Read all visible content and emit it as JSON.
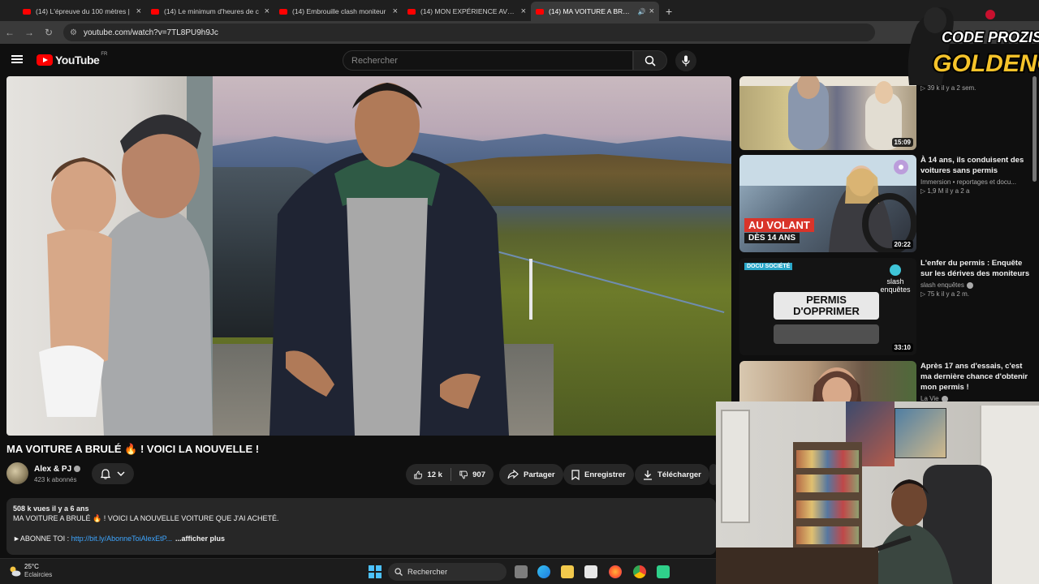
{
  "browser": {
    "tabs": [
      {
        "title": "(14) L'épreuve du 100 mètres |",
        "active": false
      },
      {
        "title": "(14) Le minimum d'heures de c",
        "active": false
      },
      {
        "title": "(14) Embrouille clash moniteur",
        "active": false
      },
      {
        "title": "(14) MON EXPÉRIENCE AVEC LE",
        "active": false
      },
      {
        "title": "(14) MA VOITURE A BRULÉ",
        "active": true
      }
    ],
    "url": "youtube.com/watch?v=7TL8PU9h9Jc"
  },
  "youtube": {
    "logo_text": "YouTube",
    "region": "FR",
    "search_placeholder": "Rechercher"
  },
  "video": {
    "title": "MA VOITURE A BRULÉ 🔥 ! VOICI LA NOUVELLE !",
    "channel": "Alex & PJ",
    "subscribers": "423 k abonnés",
    "likes": "12 k",
    "dislikes": "907",
    "share_label": "Partager",
    "save_label": "Enregistrer",
    "download_label": "Télécharger"
  },
  "description": {
    "meta": "508 k vues  il y a 6 ans",
    "line1": "MA VOITURE A BRULÉ 🔥 ! VOICI LA NOUVELLE VOITURE QUE J'AI ACHETÉ.",
    "promo_prefix": "►ABONNE TOI : ",
    "link": "http://bit.ly/AbonneToiAlexEtP...",
    "more": "...afficher plus"
  },
  "recommendations": [
    {
      "title": "",
      "channel": "",
      "stats": "▷ 39 k  il y a 2 sem.",
      "duration": "15:09"
    },
    {
      "title": "À 14 ans, ils conduisent des voitures sans permis",
      "channel": "Immersion • reportages et docu...",
      "stats": "▷ 1,9 M  il y a 2 a",
      "duration": "20:22",
      "overlay_top": "AU VOLANT",
      "overlay_bottom": "DÈS 14 ANS"
    },
    {
      "title": "L'enfer du permis : Enquête sur les dérives des moniteurs",
      "channel": "slash enquêtes",
      "stats": "▷ 75 k  il y a 2 m.",
      "duration": "33:10",
      "badge": "DOCU SOCIÉTÉ",
      "sign": "PERMIS D'OPPRIMER",
      "logo": "slash enquêtes"
    },
    {
      "title": "Après 17 ans d'essais, c'est ma dernière chance d'obtenir mon permis !",
      "channel": "La Vie",
      "stats": "",
      "duration": ""
    }
  ],
  "overlay_logo": {
    "line1": "CODE PROZIS",
    "line2": "GOLDENG"
  },
  "taskbar": {
    "temperature": "25°C",
    "condition": "Eclaircies",
    "search_label": "Rechercher"
  },
  "colors": {
    "accent_red": "#ff0000",
    "link_blue": "#3ea6ff",
    "gold": "#f5c32a"
  }
}
